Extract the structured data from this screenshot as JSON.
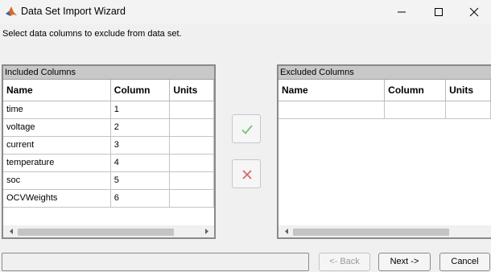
{
  "window": {
    "title": "Data Set Import Wizard",
    "icon": "matlab-logo-icon"
  },
  "instruction": "Select data columns to exclude from data set.",
  "included": {
    "header": "Included Columns",
    "columns": [
      "Name",
      "Column",
      "Units"
    ],
    "rows": [
      {
        "name": "time",
        "column": "1",
        "units": ""
      },
      {
        "name": "voltage",
        "column": "2",
        "units": ""
      },
      {
        "name": "current",
        "column": "3",
        "units": ""
      },
      {
        "name": "temperature",
        "column": "4",
        "units": ""
      },
      {
        "name": "soc",
        "column": "5",
        "units": ""
      },
      {
        "name": "OCVWeights",
        "column": "6",
        "units": ""
      }
    ]
  },
  "excluded": {
    "header": "Excluded Columns",
    "columns": [
      "Name",
      "Column",
      "Units"
    ],
    "rows": [
      {
        "name": "",
        "column": "",
        "units": ""
      }
    ]
  },
  "buttons": {
    "back": "<- Back",
    "next": "Next ->",
    "cancel": "Cancel"
  },
  "colors": {
    "include_icon": "#7ac27a",
    "exclude_icon": "#d46a6a",
    "panel_header": "#c8c8c8"
  }
}
